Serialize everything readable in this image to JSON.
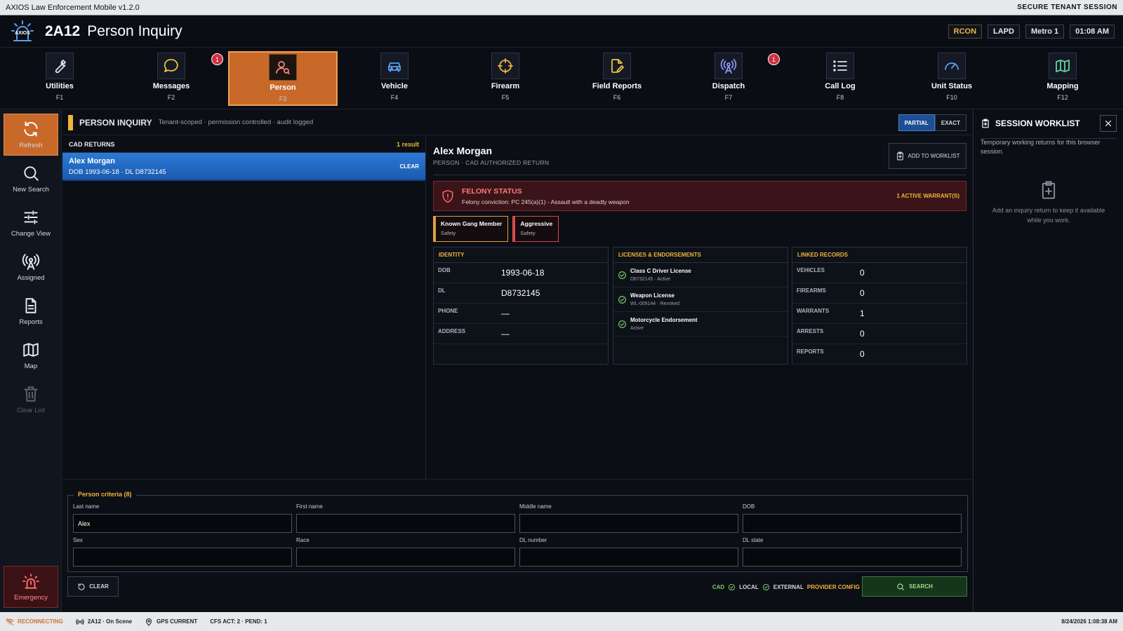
{
  "window": {
    "title": "AXIOS Law Enforcement Mobile v1.2.0",
    "session": "SECURE TENANT SESSION"
  },
  "header": {
    "logo_text": "AXIOS",
    "unit": "2A12",
    "title": "Person Inquiry",
    "badges": [
      "RCON",
      "LAPD",
      "Metro 1",
      "01:08 AM"
    ]
  },
  "toolbar": [
    {
      "label": "Utilities",
      "key": "F1",
      "icon": "wrench-icon"
    },
    {
      "label": "Messages",
      "key": "F2",
      "icon": "message-icon",
      "badge": "1"
    },
    {
      "label": "Person",
      "key": "F3",
      "icon": "person-search-icon",
      "active": true
    },
    {
      "label": "Vehicle",
      "key": "F4",
      "icon": "car-icon"
    },
    {
      "label": "Firearm",
      "key": "F5",
      "icon": "crosshair-icon"
    },
    {
      "label": "Field Reports",
      "key": "F6",
      "icon": "report-edit-icon"
    },
    {
      "label": "Dispatch",
      "key": "F7",
      "icon": "antenna-icon",
      "badge": "1"
    },
    {
      "label": "Call Log",
      "key": "F8",
      "icon": "list-icon"
    },
    {
      "label": "Unit Status",
      "key": "F10",
      "icon": "gauge-icon"
    },
    {
      "label": "Mapping",
      "key": "F12",
      "icon": "map-icon"
    }
  ],
  "sidebar": [
    {
      "label": "Refresh",
      "icon": "refresh-icon"
    },
    {
      "label": "New Search",
      "icon": "search-icon"
    },
    {
      "label": "Change View",
      "icon": "sliders-icon"
    },
    {
      "label": "Assigned",
      "icon": "antenna-icon"
    },
    {
      "label": "Reports",
      "icon": "document-icon"
    },
    {
      "label": "Map",
      "icon": "map-icon"
    },
    {
      "label": "Clear List",
      "icon": "trash-icon"
    },
    {
      "label": "Emergency",
      "icon": "siren-icon"
    }
  ],
  "panel": {
    "title": "PERSON INQUIRY",
    "subtitle": "Tenant-scoped · permission controlled · audit logged",
    "mode_partial": "PARTIAL",
    "mode_exact": "EXACT"
  },
  "returns": {
    "title": "CAD RETURNS",
    "count": "1 result",
    "items": [
      {
        "name": "Alex Morgan",
        "detail": "DOB 1993-06-18 · DL D8732145",
        "action": "CLEAR"
      }
    ]
  },
  "detail": {
    "name": "Alex Morgan",
    "subtitle": "PERSON · CAD AUTHORIZED RETURN",
    "add_label": "ADD TO WORKLIST",
    "felony": {
      "title": "FELONY STATUS",
      "desc": "Felony conviction: PC 245(a)(1) - Assault with a deadly weapon",
      "warrants": "1 ACTIVE WARRANT(S)"
    },
    "tags": [
      {
        "name": "Known Gang Member",
        "cat": "Safety"
      },
      {
        "name": "Aggressive",
        "cat": "Safety"
      }
    ],
    "identity": {
      "title": "IDENTITY",
      "rows": [
        {
          "k": "DOB",
          "v": "1993-06-18"
        },
        {
          "k": "DL",
          "v": "D8732145"
        },
        {
          "k": "PHONE",
          "v": "—"
        },
        {
          "k": "ADDRESS",
          "v": "—"
        }
      ]
    },
    "licenses": {
      "title": "LICENSES & ENDORSEMENTS",
      "rows": [
        {
          "name": "Class C Driver License",
          "sub": "D8732145 · Active"
        },
        {
          "name": "Weapon License",
          "sub": "WL-009144 · Revoked"
        },
        {
          "name": "Motorcycle Endorsement",
          "sub": "Active"
        }
      ]
    },
    "linked": {
      "title": "LINKED RECORDS",
      "rows": [
        {
          "k": "VEHICLES",
          "v": "0"
        },
        {
          "k": "FIREARMS",
          "v": "0"
        },
        {
          "k": "WARRANTS",
          "v": "1"
        },
        {
          "k": "ARRESTS",
          "v": "0"
        },
        {
          "k": "REPORTS",
          "v": "0"
        }
      ]
    }
  },
  "criteria": {
    "title": "Person criteria (8)",
    "fields": [
      {
        "label": "Last name",
        "value": "Alex"
      },
      {
        "label": "First name",
        "value": ""
      },
      {
        "label": "Middle name",
        "value": ""
      },
      {
        "label": "DOB",
        "value": ""
      },
      {
        "label": "Sex",
        "value": ""
      },
      {
        "label": "Race",
        "value": ""
      },
      {
        "label": "DL number",
        "value": ""
      },
      {
        "label": "DL state",
        "value": ""
      }
    ],
    "clear_label": "CLEAR",
    "providers": [
      "CAD",
      "LOCAL",
      "EXTERNAL"
    ],
    "provider_config": "PROVIDER CONFIG",
    "search_label": "SEARCH"
  },
  "worklist": {
    "title": "SESSION WORKLIST",
    "desc": "Temporary working returns for this browser session.",
    "empty": "Add an inquiry return to keep it available while you work."
  },
  "status": {
    "conn": "RECONNECTING",
    "unit": "2A12 · On Scene",
    "gps": "GPS CURRENT",
    "cfs": "CFS ACT: 2 · PEND: 1",
    "clock": "8/24/2026 1:08:38 AM"
  }
}
